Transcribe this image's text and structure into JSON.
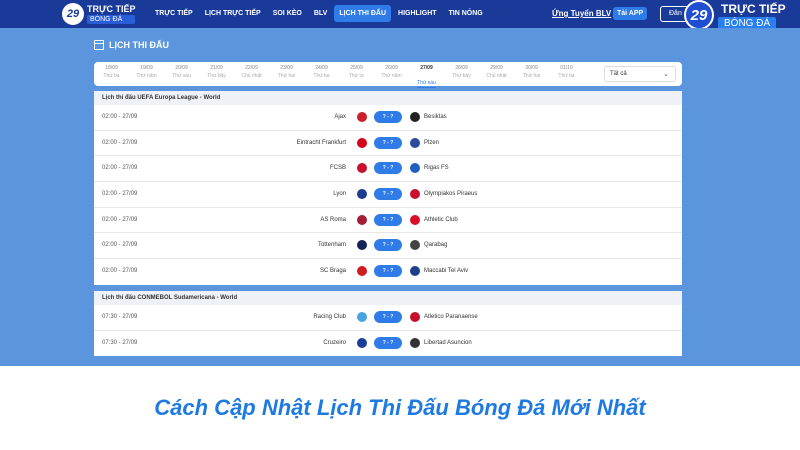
{
  "header": {
    "logo_small": {
      "mark": "29",
      "line1": "TRỰC TIẾP",
      "line2": "BÓNG ĐÁ"
    },
    "nav": [
      {
        "label": "TRỰC TIẾP"
      },
      {
        "label": "LỊCH TRỰC TIẾP"
      },
      {
        "label": "SOI KÈO"
      },
      {
        "label": "BLV"
      },
      {
        "label": "LỊCH THI ĐẤU",
        "active": true
      },
      {
        "label": "HIGHLIGHT"
      },
      {
        "label": "TIN NÓNG"
      }
    ],
    "recruit_link": "Ứng Tuyển BLV",
    "app_button": "Tải APP",
    "login_button": "Đăn",
    "brand": {
      "mark": "29",
      "line1": "TRỰC TIẾP",
      "line2": "BÓNG ĐÁ"
    }
  },
  "schedule": {
    "title": "LỊCH THI ĐẤU",
    "dates": [
      {
        "date": "18/09",
        "weekday": "Thứ ba"
      },
      {
        "date": "19/09",
        "weekday": "Thứ năm"
      },
      {
        "date": "20/09",
        "weekday": "Thứ sáu"
      },
      {
        "date": "21/09",
        "weekday": "Thứ bảy"
      },
      {
        "date": "22/09",
        "weekday": "Chủ nhật"
      },
      {
        "date": "23/09",
        "weekday": "Thứ hai"
      },
      {
        "date": "24/09",
        "weekday": "Thứ ba"
      },
      {
        "date": "25/09",
        "weekday": "Thứ tư"
      },
      {
        "date": "26/09",
        "weekday": "Thứ năm"
      },
      {
        "date": "27/09",
        "weekday": "Thứ sáu",
        "active": true
      },
      {
        "date": "28/09",
        "weekday": "Thứ bảy"
      },
      {
        "date": "29/09",
        "weekday": "Chủ nhật"
      },
      {
        "date": "30/09",
        "weekday": "Thứ hai"
      },
      {
        "date": "01/10",
        "weekday": "Thứ ba"
      }
    ],
    "filter": {
      "selected": "Tất cả"
    },
    "leagues": [
      {
        "name": "Lịch thi đấu UEFA Europa League - World",
        "matches": [
          {
            "time": "02:00 - 27/09",
            "home": "Ajax",
            "score": "? - ?",
            "away": "Besiktas",
            "home_color": "#cc1e2b",
            "away_color": "#222222"
          },
          {
            "time": "02:00 - 27/09",
            "home": "Eintracht Frankfurt",
            "score": "? - ?",
            "away": "Plzen",
            "home_color": "#d4001a",
            "away_color": "#2a4a9a"
          },
          {
            "time": "02:00 - 27/09",
            "home": "FCSB",
            "score": "? - ?",
            "away": "Rigas FS",
            "home_color": "#c8102e",
            "away_color": "#1f5fbf"
          },
          {
            "time": "02:00 - 27/09",
            "home": "Lyon",
            "score": "? - ?",
            "away": "Olympiakos Piraeus",
            "home_color": "#1d3c8f",
            "away_color": "#c8102e"
          },
          {
            "time": "02:00 - 27/09",
            "home": "AS Roma",
            "score": "? - ?",
            "away": "Athletic Club",
            "home_color": "#a31d33",
            "away_color": "#d8102a"
          },
          {
            "time": "02:00 - 27/09",
            "home": "Tottenham",
            "score": "? - ?",
            "away": "Qarabag",
            "home_color": "#132257",
            "away_color": "#444444"
          },
          {
            "time": "02:00 - 27/09",
            "home": "SC Braga",
            "score": "? - ?",
            "away": "Maccabi Tel Aviv",
            "home_color": "#d01c1f",
            "away_color": "#1b3f8a"
          }
        ]
      },
      {
        "name": "Lịch thi đấu CONMEBOL Sudamericana - World",
        "matches": [
          {
            "time": "07:30 - 27/09",
            "home": "Racing Club",
            "score": "? - ?",
            "away": "Atletico Paranaense",
            "home_color": "#4aa3df",
            "away_color": "#c8102e"
          },
          {
            "time": "07:30 - 27/09",
            "home": "Cruzeiro",
            "score": "? - ?",
            "away": "Libertad Asuncion",
            "home_color": "#1a3e9a",
            "away_color": "#333333"
          }
        ]
      }
    ]
  },
  "caption": "Cách Cập Nhật Lịch Thi Đấu Bóng Đá Mới Nhất",
  "colors": {
    "nav_bg": "#1a3a9a",
    "accent": "#2f7be8",
    "page_bg": "#5b95dd",
    "caption": "#1f7ae0"
  }
}
